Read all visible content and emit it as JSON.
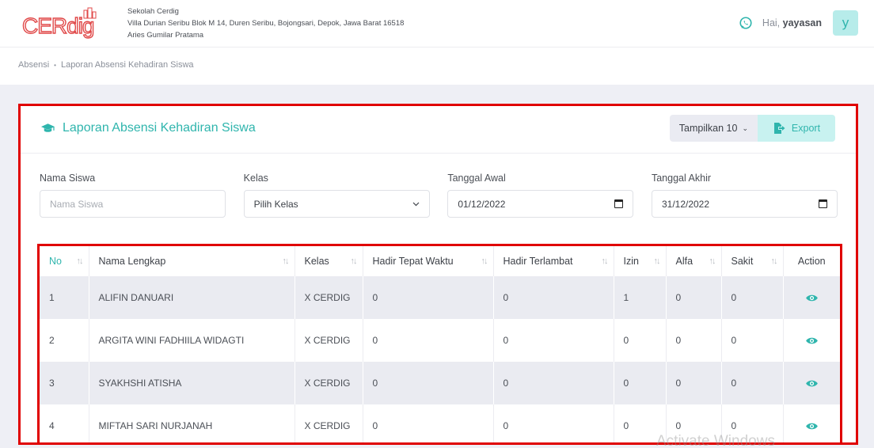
{
  "brand": {
    "logo_text": "CERdig",
    "accent": "#2fb5ad",
    "logo_color": "#e04848"
  },
  "school": {
    "name": "Sekolah Cerdig",
    "address": "Villa Durian Seribu Blok M 14, Duren Seribu, Bojongsari, Depok, Jawa Barat 16518",
    "head": "Aries Gumilar Pratama"
  },
  "user": {
    "greeting": "Hai,",
    "name": "yayasan",
    "initial": "y",
    "whatsapp_icon": "whatsapp-icon"
  },
  "breadcrumb": {
    "root": "Absensi",
    "current": "Laporan Absensi Kehadiran Siswa"
  },
  "card": {
    "title": "Laporan Absensi Kehadiran Siswa",
    "title_icon": "graduation-cap-icon",
    "show_label": "Tampilkan 10",
    "export_label": "Export"
  },
  "filters": {
    "name_label": "Nama Siswa",
    "name_placeholder": "Nama Siswa",
    "class_label": "Kelas",
    "class_value": "Pilih Kelas",
    "start_label": "Tanggal Awal",
    "start_value": "01/12/2022",
    "end_label": "Tanggal Akhir",
    "end_value": "31/12/2022"
  },
  "table": {
    "columns": [
      "No",
      "Nama Lengkap",
      "Kelas",
      "Hadir Tepat Waktu",
      "Hadir Terlambat",
      "Izin",
      "Alfa",
      "Sakit",
      "Action"
    ],
    "rows": [
      [
        "1",
        "ALIFIN DANUARI",
        "X CERDIG",
        "0",
        "0",
        "1",
        "0",
        "0"
      ],
      [
        "2",
        "ARGITA WINI FADHIILA WIDAGTI",
        "X CERDIG",
        "0",
        "0",
        "0",
        "0",
        "0"
      ],
      [
        "3",
        "SYAKHSHI ATISHA",
        "X CERDIG",
        "0",
        "0",
        "0",
        "0",
        "0"
      ],
      [
        "4",
        "MIFTAH SARI NURJANAH",
        "X CERDIG",
        "0",
        "0",
        "0",
        "0",
        "0"
      ]
    ]
  },
  "watermark": "Activate Windows"
}
